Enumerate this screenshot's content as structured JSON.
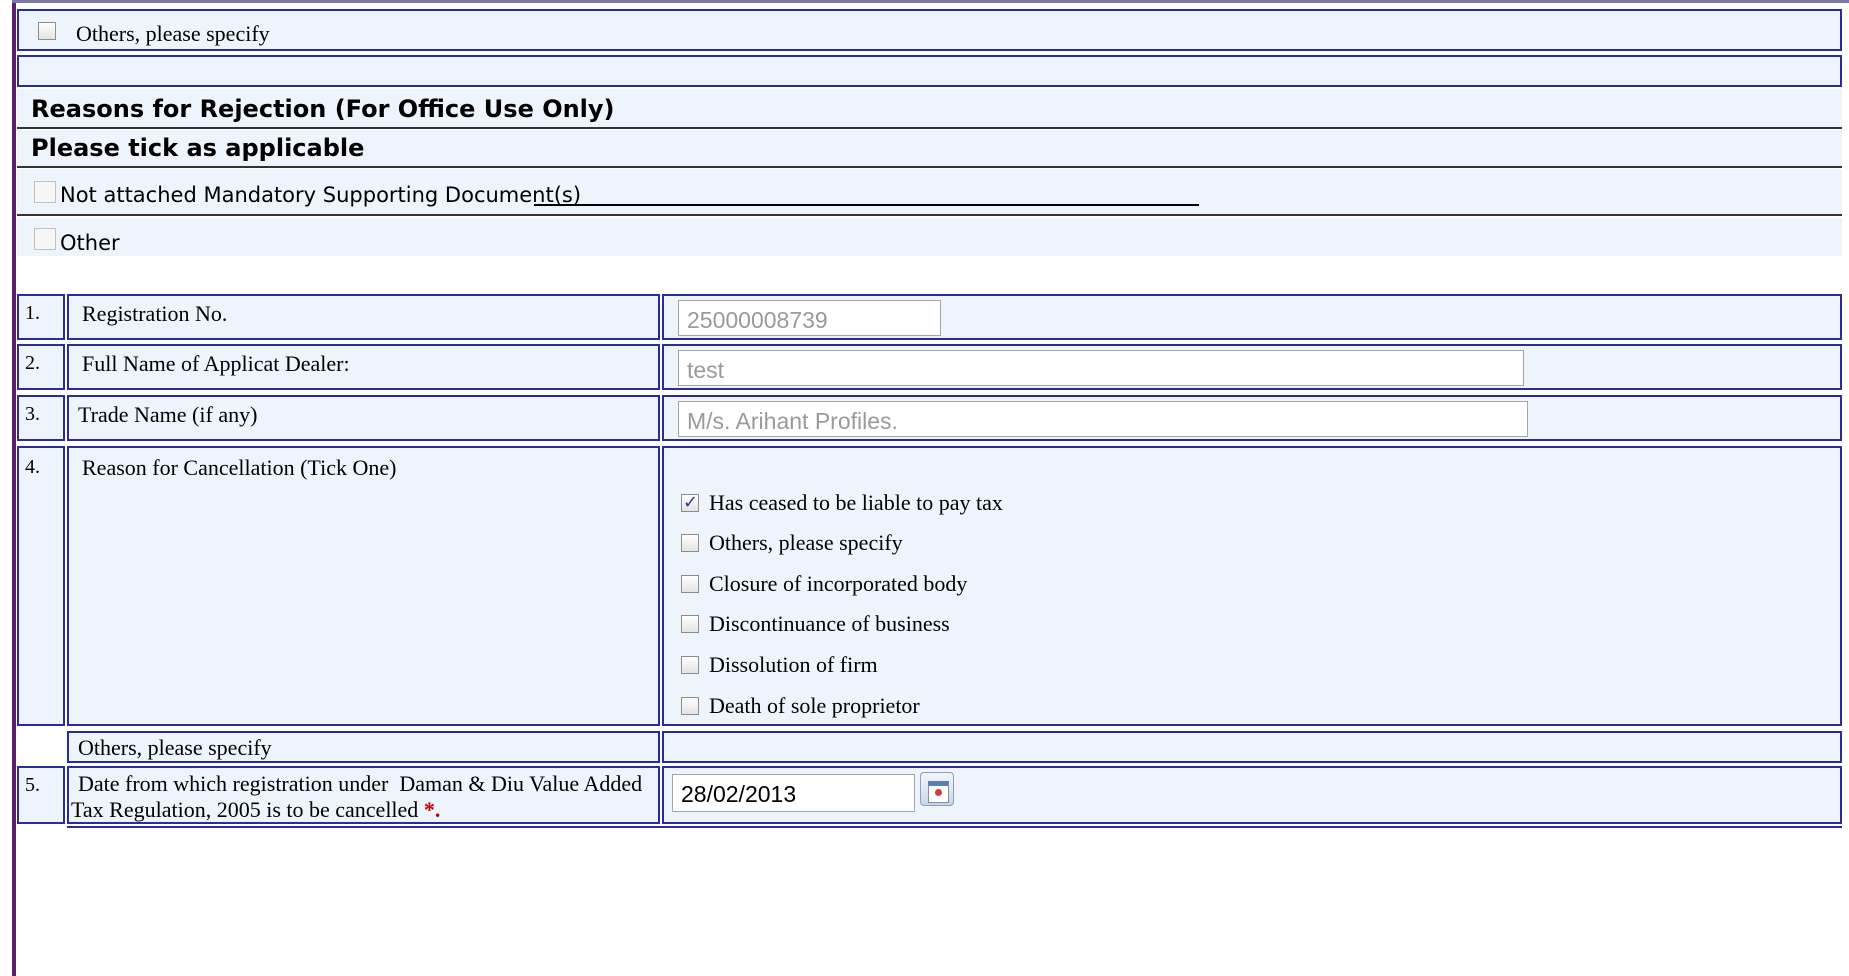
{
  "top": {
    "others_label": "Others, please specify"
  },
  "rejection": {
    "title": "Reasons for Rejection (For Office Use Only)",
    "subtitle": "Please tick as applicable",
    "not_attached_label": "Not attached Mandatory Supporting Document(s)",
    "other_label": "Other"
  },
  "rows": {
    "r1": {
      "num": "1.",
      "label": "Registration No.",
      "value": "25000008739"
    },
    "r2": {
      "num": "2.",
      "label": "Full Name of Applicat Dealer:",
      "value": "test"
    },
    "r3": {
      "num": "3.",
      "label": "Trade Name (if any)",
      "value": "M/s. Arihant Profiles."
    },
    "r4": {
      "num": "4.",
      "label": "Reason for Cancellation (Tick One)",
      "options": [
        {
          "label": "Has ceased to be liable to pay tax",
          "checked": true
        },
        {
          "label": "Others, please specify",
          "checked": false
        },
        {
          "label": "Closure of incorporated body",
          "checked": false
        },
        {
          "label": "Discontinuance of business",
          "checked": false
        },
        {
          "label": "Dissolution of firm",
          "checked": false
        },
        {
          "label": "Death of sole proprietor",
          "checked": false
        }
      ]
    },
    "others_specify": {
      "label": "Others, please specify"
    },
    "r5": {
      "num": "5.",
      "label_line1": "Date from which registration under  Daman & Diu Value Added",
      "label_line2": "Tax Regulation, 2005 is to be cancelled",
      "required_mark": "*.",
      "value": "28/02/2013"
    }
  },
  "colors": {
    "border": "#2b2b9a",
    "background": "#eef4fb",
    "frame": "#5b1f6b",
    "required": "#c80000"
  },
  "icons": [
    "checkbox",
    "calendar-icon"
  ]
}
